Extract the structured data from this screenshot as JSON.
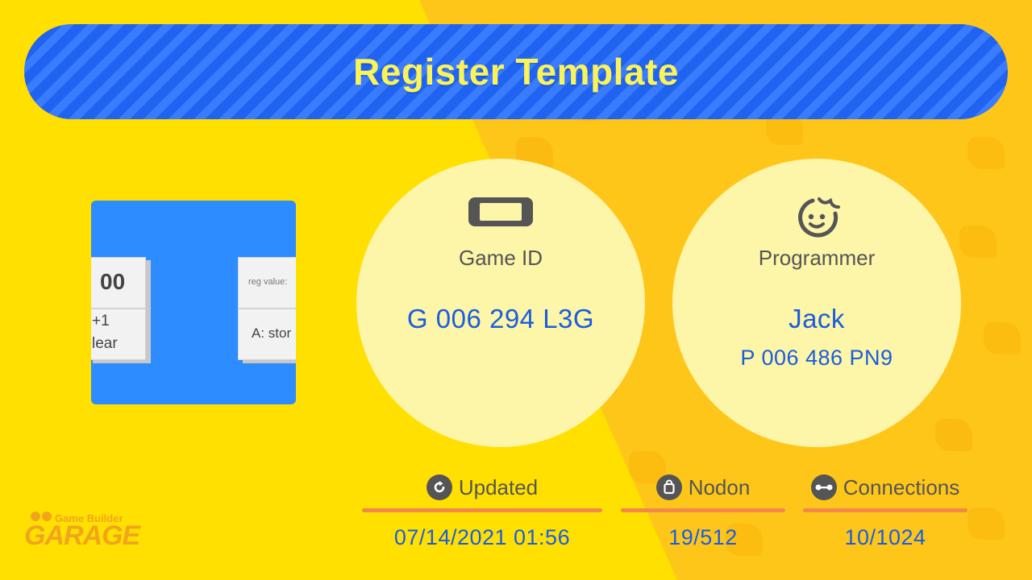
{
  "title": "Register Template",
  "thumbnail": {
    "cube_left_top": "00",
    "cube_left_bottom_line1": "+1",
    "cube_left_bottom_line2": "lear",
    "cube_right_top": "reg value:",
    "cube_right_bottom": "A: stor"
  },
  "game": {
    "icon": "console-icon",
    "label": "Game ID",
    "id": "G 006 294 L3G"
  },
  "programmer": {
    "icon": "face-icon",
    "label": "Programmer",
    "name": "Jack",
    "id": "P 006 486 PN9"
  },
  "stats": {
    "updated": {
      "icon": "refresh-icon",
      "label": "Updated",
      "value": "07/14/2021 01:56"
    },
    "nodon": {
      "icon": "bag-icon",
      "label": "Nodon",
      "value": "19/512"
    },
    "connections": {
      "icon": "link-icon",
      "label": "Connections",
      "value": "10/1024"
    }
  },
  "logo": {
    "top_text": "Game Builder",
    "main_text": "GARAGE"
  },
  "colors": {
    "background": "#ffe000",
    "banner": "#1f63f0",
    "title_text": "#fbf35a",
    "value_text": "#1a5de0",
    "underline": "#f4884a",
    "circle": "#fdf5a8"
  }
}
